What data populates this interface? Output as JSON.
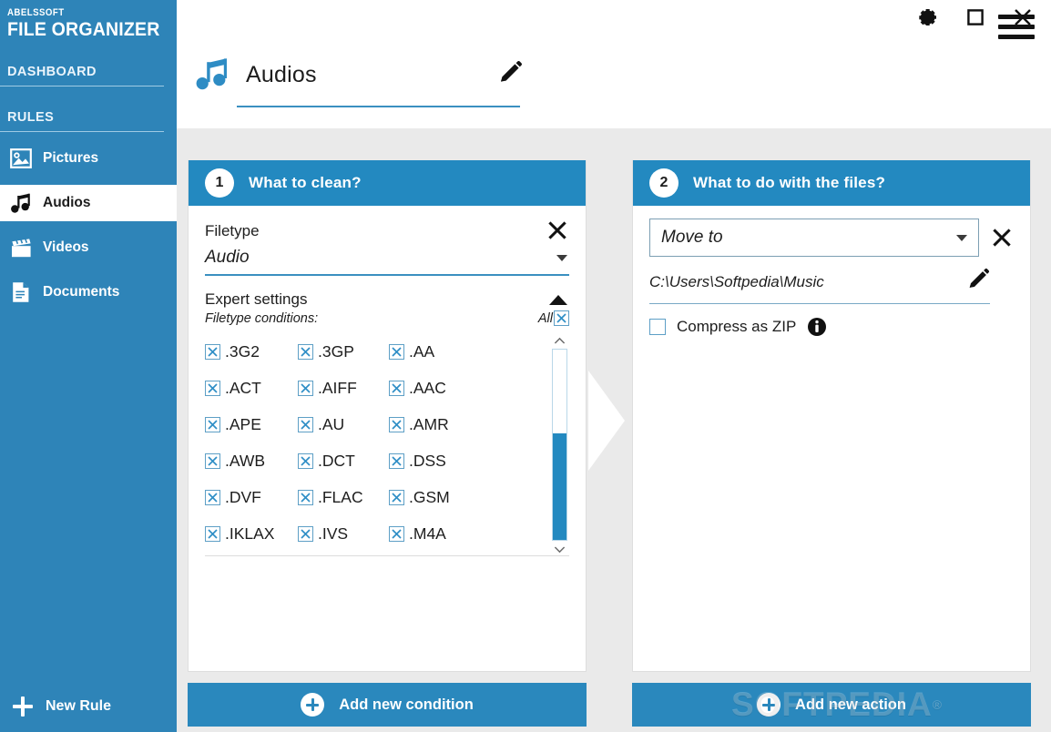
{
  "app": {
    "brand_sub": "ABELSSOFT",
    "brand_main": "FILE ORGANIZER"
  },
  "titlebar": {
    "settings_icon": "gear-icon",
    "maximize_icon": "maximize-icon",
    "close_icon": "close-icon"
  },
  "sidebar": {
    "dashboard_label": "DASHBOARD",
    "rules_label": "RULES",
    "items": [
      {
        "label": "Pictures",
        "icon": "picture-icon",
        "active": false
      },
      {
        "label": "Audios",
        "icon": "music-note-icon",
        "active": true
      },
      {
        "label": "Videos",
        "icon": "clapperboard-icon",
        "active": false
      },
      {
        "label": "Documents",
        "icon": "document-icon",
        "active": false
      }
    ],
    "new_rule_label": "New Rule"
  },
  "page": {
    "title": "Audios",
    "icon": "music-note-icon",
    "edit_icon": "pencil-icon",
    "menu_icon": "hamburger-icon"
  },
  "panel_left": {
    "step": "1",
    "title": "What to clean?",
    "filetype_label": "Filetype",
    "filetype_value": "Audio",
    "close_icon": "close-icon",
    "expert_label": "Expert settings",
    "collapse_icon": "chevron-up-icon",
    "conditions_label": "Filetype conditions:",
    "all_label": "All",
    "extensions": [
      ".3G2",
      ".3GP",
      ".AA",
      ".ACT",
      ".AIFF",
      ".AAC",
      ".APE",
      ".AU",
      ".AMR",
      ".AWB",
      ".DCT",
      ".DSS",
      ".DVF",
      ".FLAC",
      ".GSM",
      ".IKLAX",
      ".IVS",
      ".M4A"
    ],
    "footer_button": "Add new condition"
  },
  "panel_right": {
    "step": "2",
    "title": "What to do with the files?",
    "action_value": "Move to",
    "close_icon": "close-icon",
    "path_value": "C:\\Users\\Softpedia\\Music",
    "path_edit_icon": "pencil-icon",
    "zip_label": "Compress as ZIP",
    "info_icon": "info-icon",
    "footer_button": "Add new action"
  },
  "watermark": {
    "text": "SOFTPEDIA",
    "registered": "®"
  },
  "colors": {
    "sidebar_blue": "#2e84b8",
    "panel_header_blue": "#2389c0",
    "button_blue": "#2a88bd",
    "content_bg": "#eaeaea",
    "accent_underline": "#3a90c0"
  }
}
